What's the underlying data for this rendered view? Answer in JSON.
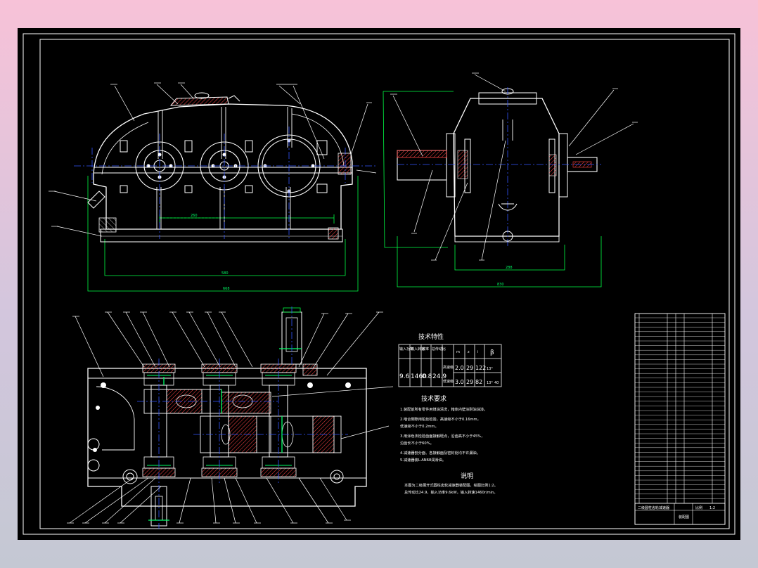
{
  "sheet": {
    "tech_spec_title": "技术特性",
    "spec_table": {
      "headers": [
        "输入功率",
        "输入转速",
        "效率",
        "总传动比",
        "m",
        "z",
        "i",
        "β"
      ],
      "rows": [
        [
          "9.6",
          "1460",
          "0.8",
          "24.9",
          "高速级",
          "2.0",
          "29",
          "122",
          "13°",
          ""
        ],
        [
          "",
          "",
          "",
          "",
          "低速级",
          "3.0",
          "29",
          "82",
          "13°",
          "40"
        ]
      ]
    },
    "tech_req_title": "技术要求",
    "tech_req_items": [
      "1.装配前所有零件用煤油清洗，箱体内壁涂耐油油漆。",
      "2.啮合侧隙用铅丝检验，高速级不小于0.16mm，",
      "  低速级不小于0.2mm。",
      "3.用涂色法检验齿面接触斑点，沿齿高不小于45%，",
      "  沿齿长不小于60%。",
      "4.减速器剖分面、各接触面及密封处均不许漏油。",
      "5.减速器装L-AN68润滑油。"
    ],
    "notes_title": "说明",
    "notes_items": [
      "本图为二级展开式圆柱齿轮减速器装配图，绘图比例1:2。",
      "总传动比24.9，输入功率9.6kW，输入转速1460r/min。"
    ],
    "title_block": {
      "drawing_name": "二级圆柱齿轮减速器",
      "label_1": "装配图",
      "label_2": "比例",
      "label_3": "1:2"
    }
  },
  "colors": {
    "background": "#000000",
    "outline": "#ffffff",
    "center": "#3355ff",
    "dimension": "#00ff44",
    "hatch": "#ff4444",
    "accent": "#ffff00",
    "gear_teeth": "#00ff66"
  }
}
